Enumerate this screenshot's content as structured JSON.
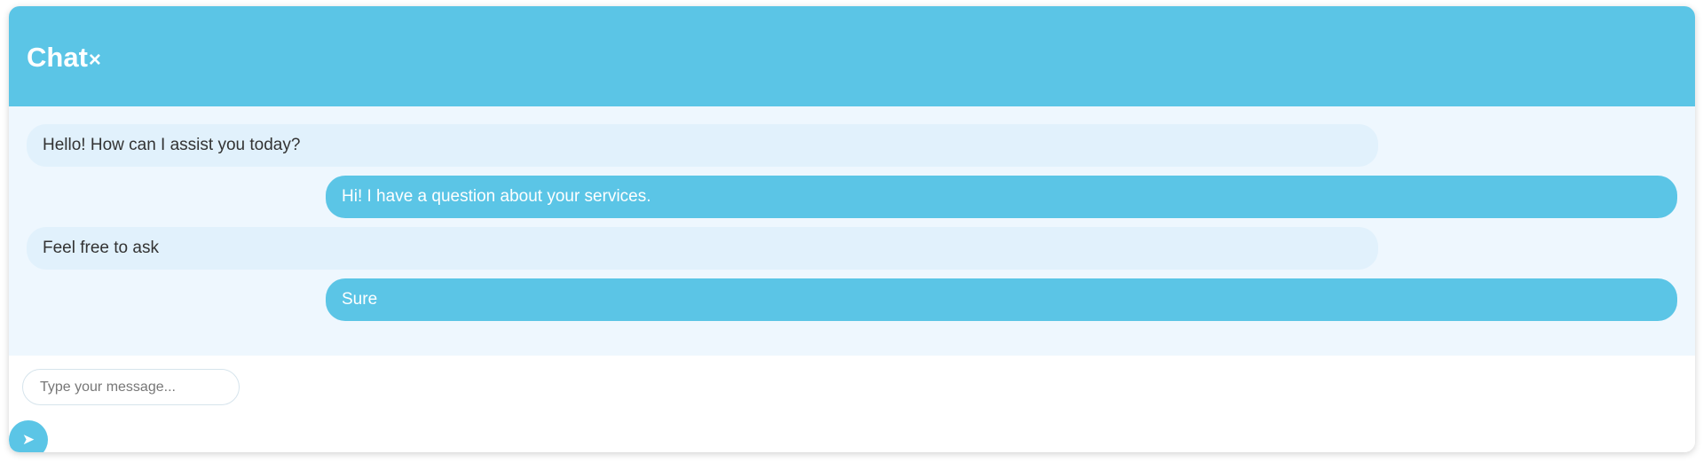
{
  "header": {
    "title": "Chat",
    "close_glyph": "×"
  },
  "messages": [
    {
      "sender": "bot",
      "text": "Hello! How can I assist you today?"
    },
    {
      "sender": "user",
      "text": "Hi! I have a question about your services."
    },
    {
      "sender": "bot",
      "text": "Feel free to ask"
    },
    {
      "sender": "user",
      "text": "Sure"
    }
  ],
  "composer": {
    "value": "",
    "placeholder": "Type your message...",
    "send_glyph": "➤"
  },
  "colors": {
    "accent": "#5bc5e6",
    "messages_background": "#eef7fe",
    "bot_bubble": "#e1f1fc",
    "user_bubble": "#5bc5e6"
  },
  "icons": {
    "close": "close-icon",
    "send": "send-icon"
  }
}
